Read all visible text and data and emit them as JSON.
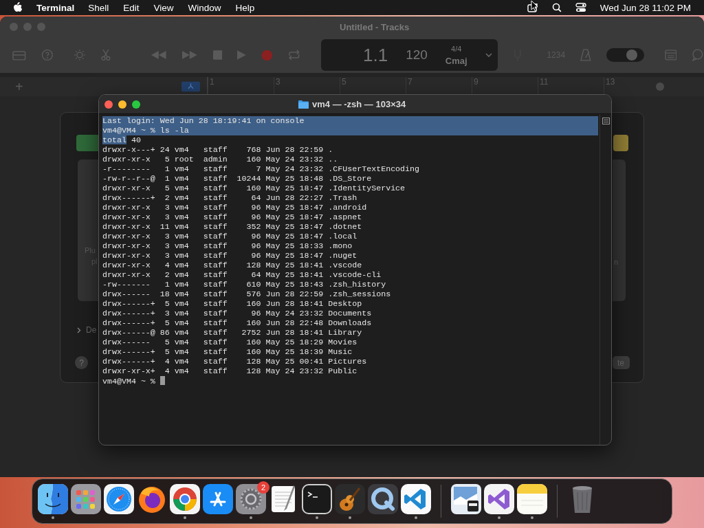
{
  "menu_bar": {
    "app": "Terminal",
    "menus": [
      "Shell",
      "Edit",
      "View",
      "Window",
      "Help"
    ],
    "clock": "Wed Jun 28  11:02 PM"
  },
  "background_window": {
    "title": "Untitled - Tracks",
    "lcd": {
      "bar_beat": "1.1",
      "tempo": "120",
      "time_signature": "4/4",
      "key": "Cmaj"
    },
    "count_in": "1234",
    "toggle_on": true,
    "add_track": "+",
    "ruler": [
      "1",
      "3",
      "5",
      "7",
      "9",
      "11",
      "13"
    ],
    "dialog": {
      "left_panel_texts": [
        "Plu",
        "pl"
      ],
      "details_label": "De",
      "right_panel_text": "n",
      "help": "?",
      "button": "te"
    }
  },
  "terminal": {
    "title": "vm4 — -zsh — 103×34",
    "lines": [
      {
        "text": "Last login: Wed Jun 28 18:19:41 on console",
        "selected": true
      },
      {
        "text": "vm4@VM4 ~ % ls -la",
        "selected": true
      },
      {
        "parts": [
          {
            "text": "total",
            "selected": true
          },
          {
            "text": " 40",
            "selected": false
          }
        ]
      },
      {
        "text": "drwxr-x---+ 24 vm4   staff    768 Jun 28 22:59 .",
        "selected": false
      },
      {
        "text": "drwxr-xr-x   5 root  admin    160 May 24 23:32 ..",
        "selected": false
      },
      {
        "text": "-r--------   1 vm4   staff      7 May 24 23:32 .CFUserTextEncoding",
        "selected": false
      },
      {
        "text": "-rw-r--r--@  1 vm4   staff  10244 May 25 18:48 .DS_Store",
        "selected": false
      },
      {
        "text": "drwxr-xr-x   5 vm4   staff    160 May 25 18:47 .IdentityService",
        "selected": false
      },
      {
        "text": "drwx------+  2 vm4   staff     64 Jun 28 22:27 .Trash",
        "selected": false
      },
      {
        "text": "drwxr-xr-x   3 vm4   staff     96 May 25 18:47 .android",
        "selected": false
      },
      {
        "text": "drwxr-xr-x   3 vm4   staff     96 May 25 18:47 .aspnet",
        "selected": false
      },
      {
        "text": "drwxr-xr-x  11 vm4   staff    352 May 25 18:47 .dotnet",
        "selected": false
      },
      {
        "text": "drwxr-xr-x   3 vm4   staff     96 May 25 18:47 .local",
        "selected": false
      },
      {
        "text": "drwxr-xr-x   3 vm4   staff     96 May 25 18:33 .mono",
        "selected": false
      },
      {
        "text": "drwxr-xr-x   3 vm4   staff     96 May 25 18:47 .nuget",
        "selected": false
      },
      {
        "text": "drwxr-xr-x   4 vm4   staff    128 May 25 18:41 .vscode",
        "selected": false
      },
      {
        "text": "drwxr-xr-x   2 vm4   staff     64 May 25 18:41 .vscode-cli",
        "selected": false
      },
      {
        "text": "-rw-------   1 vm4   staff    610 May 25 18:43 .zsh_history",
        "selected": false
      },
      {
        "text": "drwx------  18 vm4   staff    576 Jun 28 22:59 .zsh_sessions",
        "selected": false
      },
      {
        "text": "drwx------+  5 vm4   staff    160 Jun 28 18:41 Desktop",
        "selected": false
      },
      {
        "text": "drwx------+  3 vm4   staff     96 May 24 23:32 Documents",
        "selected": false
      },
      {
        "text": "drwx------+  5 vm4   staff    160 Jun 28 22:48 Downloads",
        "selected": false
      },
      {
        "text": "drwx------@ 86 vm4   staff   2752 Jun 28 18:41 Library",
        "selected": false
      },
      {
        "text": "drwx------   5 vm4   staff    160 May 25 18:29 Movies",
        "selected": false
      },
      {
        "text": "drwx------+  5 vm4   staff    160 May 25 18:39 Music",
        "selected": false
      },
      {
        "text": "drwx------+  4 vm4   staff    128 May 25 00:41 Pictures",
        "selected": false
      },
      {
        "text": "drwxr-xr-x+  4 vm4   staff    128 May 24 23:32 Public",
        "selected": false
      }
    ],
    "prompt": "vm4@VM4 ~ %"
  },
  "dock": {
    "apps": [
      {
        "kind": "finder",
        "running": true
      },
      {
        "kind": "launchpad",
        "running": false
      },
      {
        "kind": "safari",
        "running": false
      },
      {
        "kind": "firefox",
        "running": false
      },
      {
        "kind": "chrome",
        "running": true
      },
      {
        "kind": "appstore",
        "running": false
      },
      {
        "kind": "settings",
        "running": true,
        "badge": "2"
      },
      {
        "kind": "textedit",
        "running": false
      },
      {
        "kind": "terminal",
        "running": true
      },
      {
        "kind": "garageband",
        "running": true
      },
      {
        "kind": "quicktime",
        "running": false
      },
      {
        "kind": "vscode",
        "running": true
      }
    ],
    "recent_apps": [
      {
        "kind": "preview",
        "running": false
      },
      {
        "kind": "visualstudio",
        "running": true
      },
      {
        "kind": "notes",
        "running": true
      }
    ]
  }
}
